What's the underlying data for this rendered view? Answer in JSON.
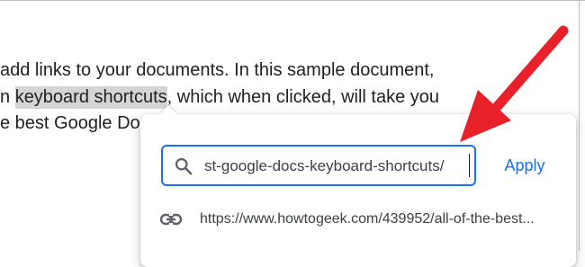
{
  "document": {
    "line1": "add links to your documents. In this sample document,",
    "line2_before": "n ",
    "line2_link": "keyboard shortcuts",
    "line2_after": ", which when clicked, will take you",
    "line3": "e best Google Do"
  },
  "link_popup": {
    "url_value": "st-google-docs-keyboard-shortcuts/",
    "apply_label": "Apply",
    "suggestion": "https://www.howtogeek.com/439952/all-of-the-best..."
  },
  "icons": {
    "search": "search-icon",
    "link": "link-icon",
    "annotation": "red-arrow-icon"
  },
  "colors": {
    "accent": "#1a73e8",
    "annotation": "#e8202a",
    "highlight": "#d5d5d5"
  }
}
